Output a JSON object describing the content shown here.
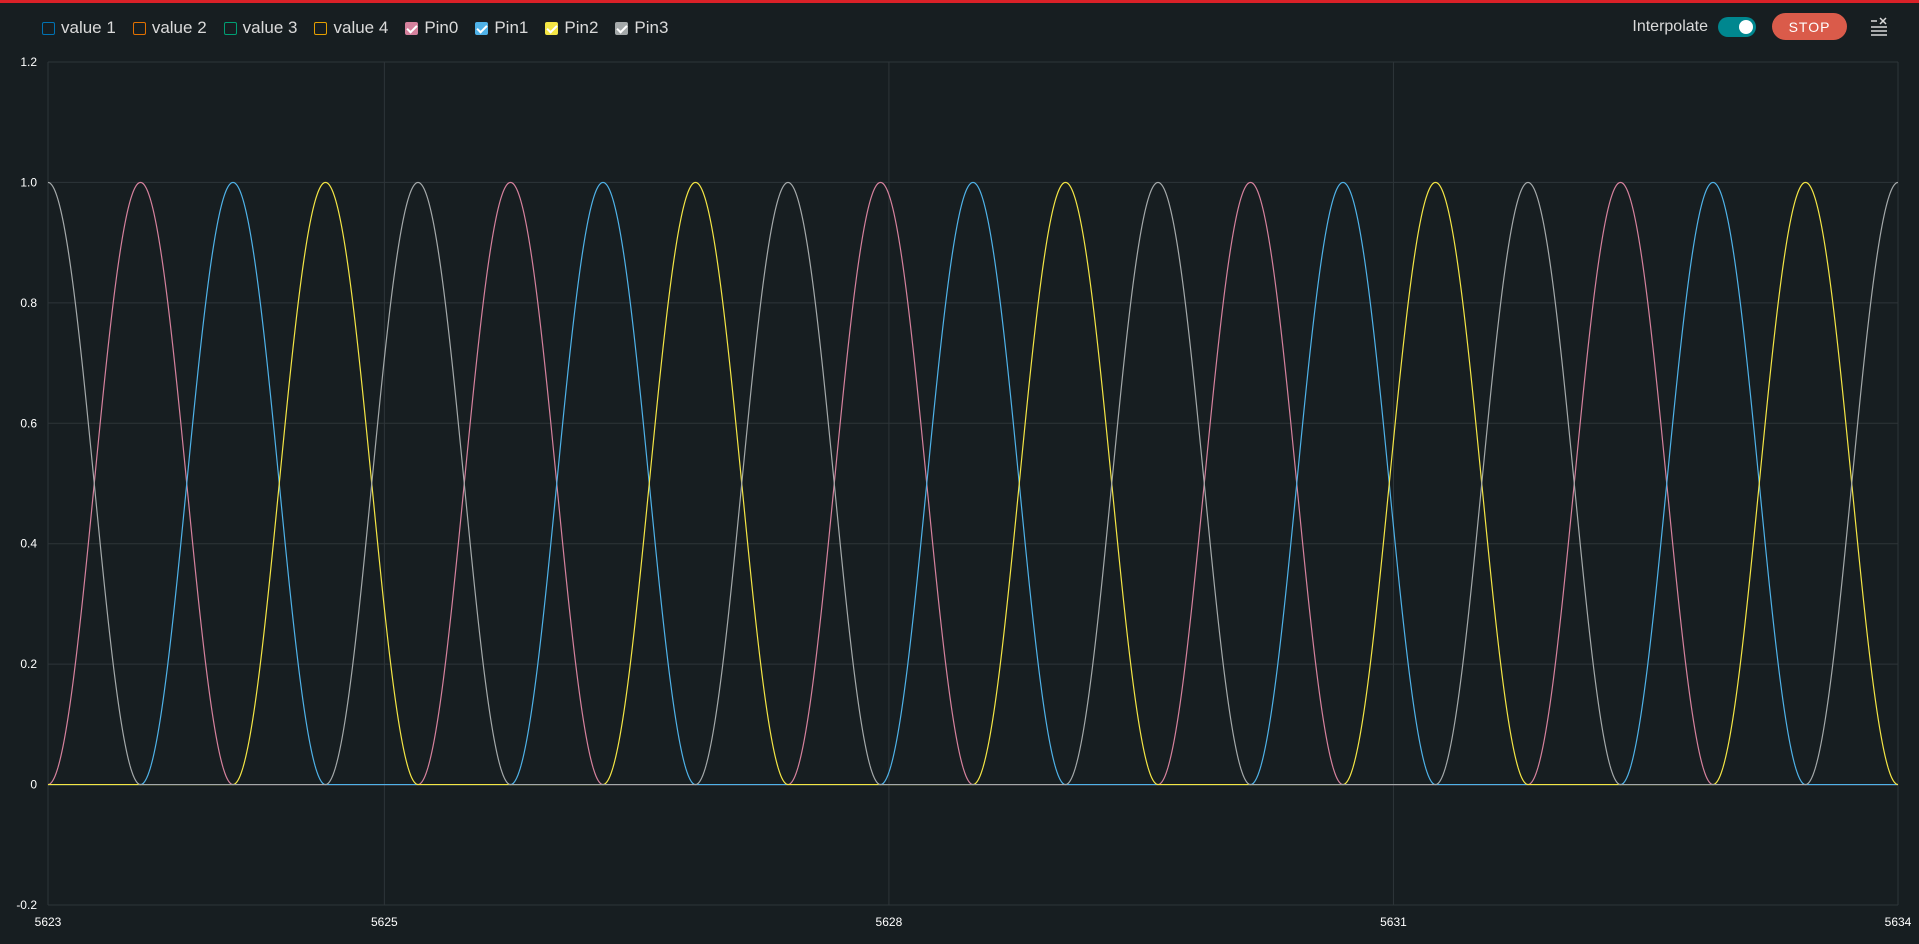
{
  "legend": [
    {
      "label": "value 1",
      "color": "#0072b2",
      "checked": false
    },
    {
      "label": "value 2",
      "color": "#e17000",
      "checked": false
    },
    {
      "label": "value 3",
      "color": "#009e73",
      "checked": false
    },
    {
      "label": "value 4",
      "color": "#e59f00",
      "checked": false
    },
    {
      "label": "Pin0",
      "color": "#d5819d",
      "checked": true
    },
    {
      "label": "Pin1",
      "color": "#4fb2e8",
      "checked": true
    },
    {
      "label": "Pin2",
      "color": "#f4e645",
      "checked": true
    },
    {
      "label": "Pin3",
      "color": "#a4a9aa",
      "checked": true
    }
  ],
  "controls": {
    "interpolate_label": "Interpolate",
    "interpolate_on": true,
    "stop_label": "STOP",
    "clear_icon": "clear-list-icon"
  },
  "theme": {
    "background": "#171e21",
    "accent_bar": "#da2128",
    "grid": "#2e3539"
  },
  "chart_data": {
    "type": "line",
    "xlim": [
      5623,
      5634
    ],
    "ylim": [
      -0.2,
      1.2
    ],
    "x_ticks": [
      5623,
      5625,
      5628,
      5631,
      5634
    ],
    "y_ticks": [
      -0.2,
      0,
      0.2,
      0.4,
      0.6,
      0.8,
      1.0,
      1.2
    ],
    "grid": true,
    "legend_placement": "top-left",
    "series": [
      {
        "name": "Pin0",
        "color": "#d5819d",
        "phase": 0,
        "visible": true
      },
      {
        "name": "Pin1",
        "color": "#4fb2e8",
        "phase": 1,
        "visible": true
      },
      {
        "name": "Pin2",
        "color": "#f4e645",
        "phase": 2,
        "visible": true
      },
      {
        "name": "Pin3",
        "color": "#a4a9aa",
        "phase": 3,
        "visible": true
      }
    ],
    "pulse_period": 1.1,
    "pulse_cycle": 4
  }
}
